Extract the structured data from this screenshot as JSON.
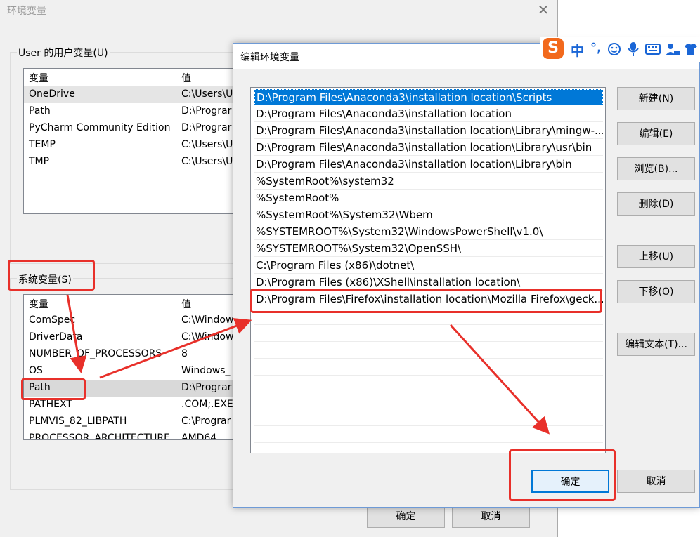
{
  "env_dialog": {
    "title": "环境变量",
    "close_glyph": "✕",
    "user_group_label": "User 的用户变量(U)",
    "user_headers": [
      "变量",
      "值"
    ],
    "user_vars": [
      {
        "name": "OneDrive",
        "value": "C:\\Users\\U"
      },
      {
        "name": "Path",
        "value": "D:\\Prograr"
      },
      {
        "name": "PyCharm Community Edition",
        "value": "D:\\Prograr"
      },
      {
        "name": "TEMP",
        "value": "C:\\Users\\U"
      },
      {
        "name": "TMP",
        "value": "C:\\Users\\U"
      }
    ],
    "system_group_label": "系统变量(S)",
    "system_headers": [
      "变量",
      "值"
    ],
    "system_vars": [
      {
        "name": "ComSpec",
        "value": "C:\\Window"
      },
      {
        "name": "DriverData",
        "value": "C:\\Window"
      },
      {
        "name": "NUMBER_OF_PROCESSORS",
        "value": "8"
      },
      {
        "name": "OS",
        "value": "Windows_"
      },
      {
        "name": "Path",
        "value": "D:\\Prograr"
      },
      {
        "name": "PATHEXT",
        "value": ".COM;.EXE"
      },
      {
        "name": "PLMVIS_82_LIBPATH",
        "value": "C:\\Prograr"
      },
      {
        "name": "PROCESSOR_ARCHITECTURE",
        "value": "AMD64"
      }
    ],
    "ok_label": "确定",
    "cancel_label": "取消"
  },
  "edit_dialog": {
    "title": "编辑环境变量",
    "paths": [
      "D:\\Program Files\\Anaconda3\\installation location\\Scripts",
      "D:\\Program Files\\Anaconda3\\installation location",
      "D:\\Program Files\\Anaconda3\\installation location\\Library\\mingw-...",
      "D:\\Program Files\\Anaconda3\\installation location\\Library\\usr\\bin",
      "D:\\Program Files\\Anaconda3\\installation location\\Library\\bin",
      "%SystemRoot%\\system32",
      "%SystemRoot%",
      "%SystemRoot%\\System32\\Wbem",
      "%SYSTEMROOT%\\System32\\WindowsPowerShell\\v1.0\\",
      "%SYSTEMROOT%\\System32\\OpenSSH\\",
      "C:\\Program Files (x86)\\dotnet\\",
      "D:\\Program Files (x86)\\XShell\\installation location\\",
      "D:\\Program Files\\Firefox\\installation location\\Mozilla Firefox\\geck..."
    ],
    "buttons": {
      "new": "新建(N)",
      "edit": "编辑(E)",
      "browse": "浏览(B)...",
      "delete": "删除(D)",
      "move_up": "上移(U)",
      "move_down": "下移(O)",
      "edit_text": "编辑文本(T)..."
    },
    "ok_label": "确定",
    "cancel_label": "取消"
  },
  "ime_toolbar": {
    "logo": "S",
    "mode": "中",
    "punct": "°,",
    "icons": [
      "emoji-icon",
      "microphone-icon",
      "keyboard-icon",
      "user-tools-icon",
      "skin-icon"
    ]
  },
  "colors": {
    "annotation_red": "#e8302a",
    "selection_blue": "#0078d7",
    "ime_orange": "#f2691c"
  }
}
